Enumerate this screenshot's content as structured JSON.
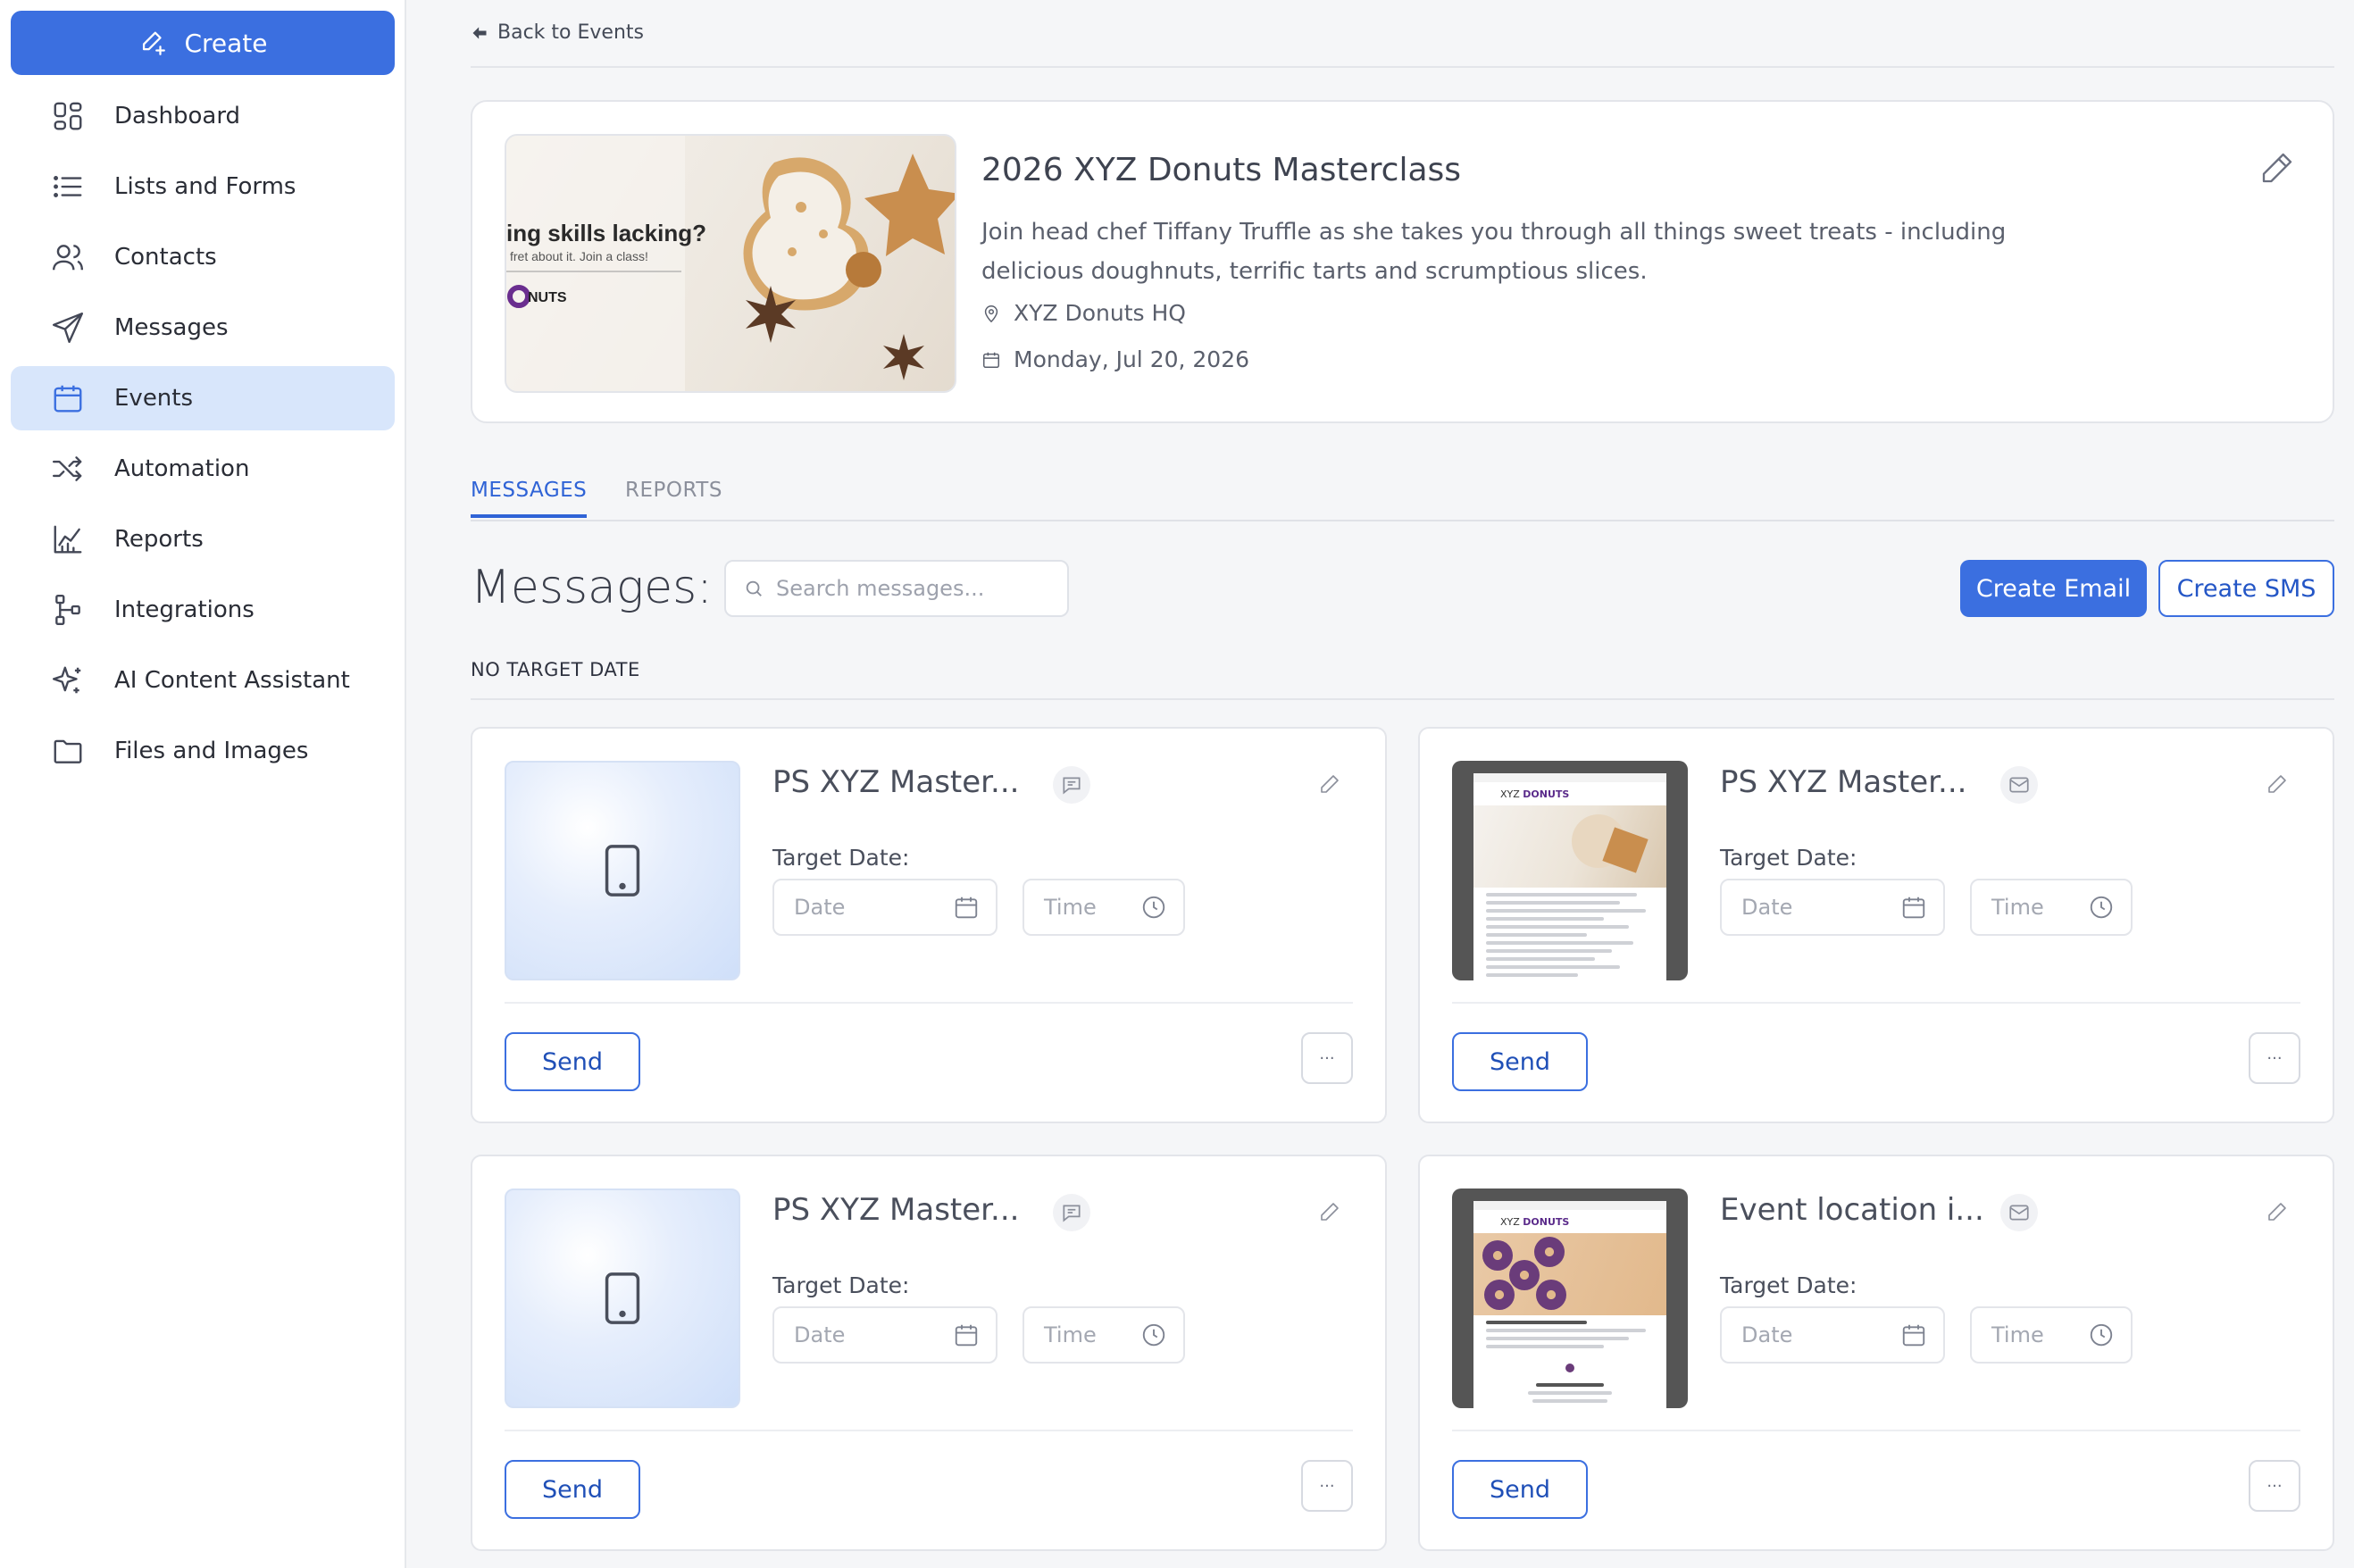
{
  "sidebar": {
    "create_label": "Create",
    "items": [
      {
        "label": "Dashboard",
        "icon": "dashboard-icon"
      },
      {
        "label": "Lists and Forms",
        "icon": "list-icon"
      },
      {
        "label": "Contacts",
        "icon": "contacts-icon"
      },
      {
        "label": "Messages",
        "icon": "send-icon"
      },
      {
        "label": "Events",
        "icon": "calendar-icon",
        "active": true
      },
      {
        "label": "Automation",
        "icon": "shuffle-icon"
      },
      {
        "label": "Reports",
        "icon": "chart-icon"
      },
      {
        "label": "Integrations",
        "icon": "integrations-icon"
      },
      {
        "label": "AI Content Assistant",
        "icon": "sparkle-icon"
      },
      {
        "label": "Files and Images",
        "icon": "folder-icon"
      }
    ]
  },
  "header": {
    "back_label": "Back to Events"
  },
  "event": {
    "title": "2026 XYZ Donuts Masterclass",
    "description": "Join head chef Tiffany Truffle as she takes you through all things sweet treats - including delicious doughnuts, terrific tarts and scrumptious slices.",
    "location": "XYZ Donuts HQ",
    "date": "Monday, Jul 20, 2026",
    "image_text": {
      "headline": "ing skills lacking?",
      "sub": "fret about it. Join a class!",
      "brand": "NUTS"
    }
  },
  "tabs": [
    {
      "label": "MESSAGES",
      "active": true
    },
    {
      "label": "REPORTS",
      "active": false
    }
  ],
  "messages": {
    "heading": "Messages:",
    "search_placeholder": "Search messages...",
    "create_email_label": "Create Email",
    "create_sms_label": "Create SMS",
    "section_label": "NO TARGET DATE",
    "cards": [
      {
        "title": "PS XYZ Master...",
        "type": "sms",
        "target_label": "Target Date:",
        "date_placeholder": "Date",
        "time_placeholder": "Time",
        "send_label": "Send",
        "more_label": "···"
      },
      {
        "title": "PS XYZ Master...",
        "type": "email",
        "target_label": "Target Date:",
        "date_placeholder": "Date",
        "time_placeholder": "Time",
        "send_label": "Send",
        "more_label": "···"
      },
      {
        "title": "PS XYZ Master...",
        "type": "sms",
        "target_label": "Target Date:",
        "date_placeholder": "Date",
        "time_placeholder": "Time",
        "send_label": "Send",
        "more_label": "···"
      },
      {
        "title": "Event location i...",
        "type": "email",
        "target_label": "Target Date:",
        "date_placeholder": "Date",
        "time_placeholder": "Time",
        "send_label": "Send",
        "more_label": "···"
      }
    ]
  },
  "colors": {
    "primary": "#3b6fe0",
    "active_nav_bg": "#d8e6fb",
    "background": "#f5f6f8"
  }
}
